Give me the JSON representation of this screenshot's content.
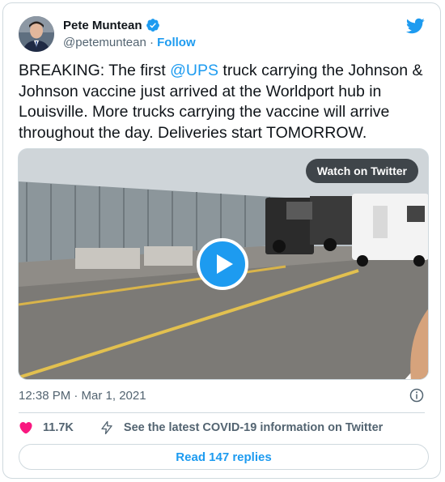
{
  "author": {
    "name": "Pete Muntean",
    "handle": "@petemuntean",
    "separator": "·",
    "follow_label": "Follow"
  },
  "tweet": {
    "text_before": "BREAKING: The first ",
    "mention": "@UPS",
    "text_after": " truck carrying the Johnson & Johnson vaccine just arrived at the Worldport hub in Louisville. More trucks carrying the vaccine will arrive throughout the day. Deliveries start TOMORROW."
  },
  "media": {
    "watch_label": "Watch on Twitter"
  },
  "meta": {
    "timestamp": "12:38 PM · Mar 1, 2021"
  },
  "actions": {
    "likes": "11.7K",
    "covid_link": "See the latest COVID-19 information on Twitter",
    "replies_button": "Read 147 replies"
  },
  "colors": {
    "accent": "#1d9bf0",
    "heart": "#f91880",
    "muted_text": "#536471"
  },
  "icons": [
    "verified-badge-icon",
    "twitter-bird-icon",
    "play-icon",
    "info-icon",
    "heart-icon",
    "lightning-bolt-icon"
  ]
}
